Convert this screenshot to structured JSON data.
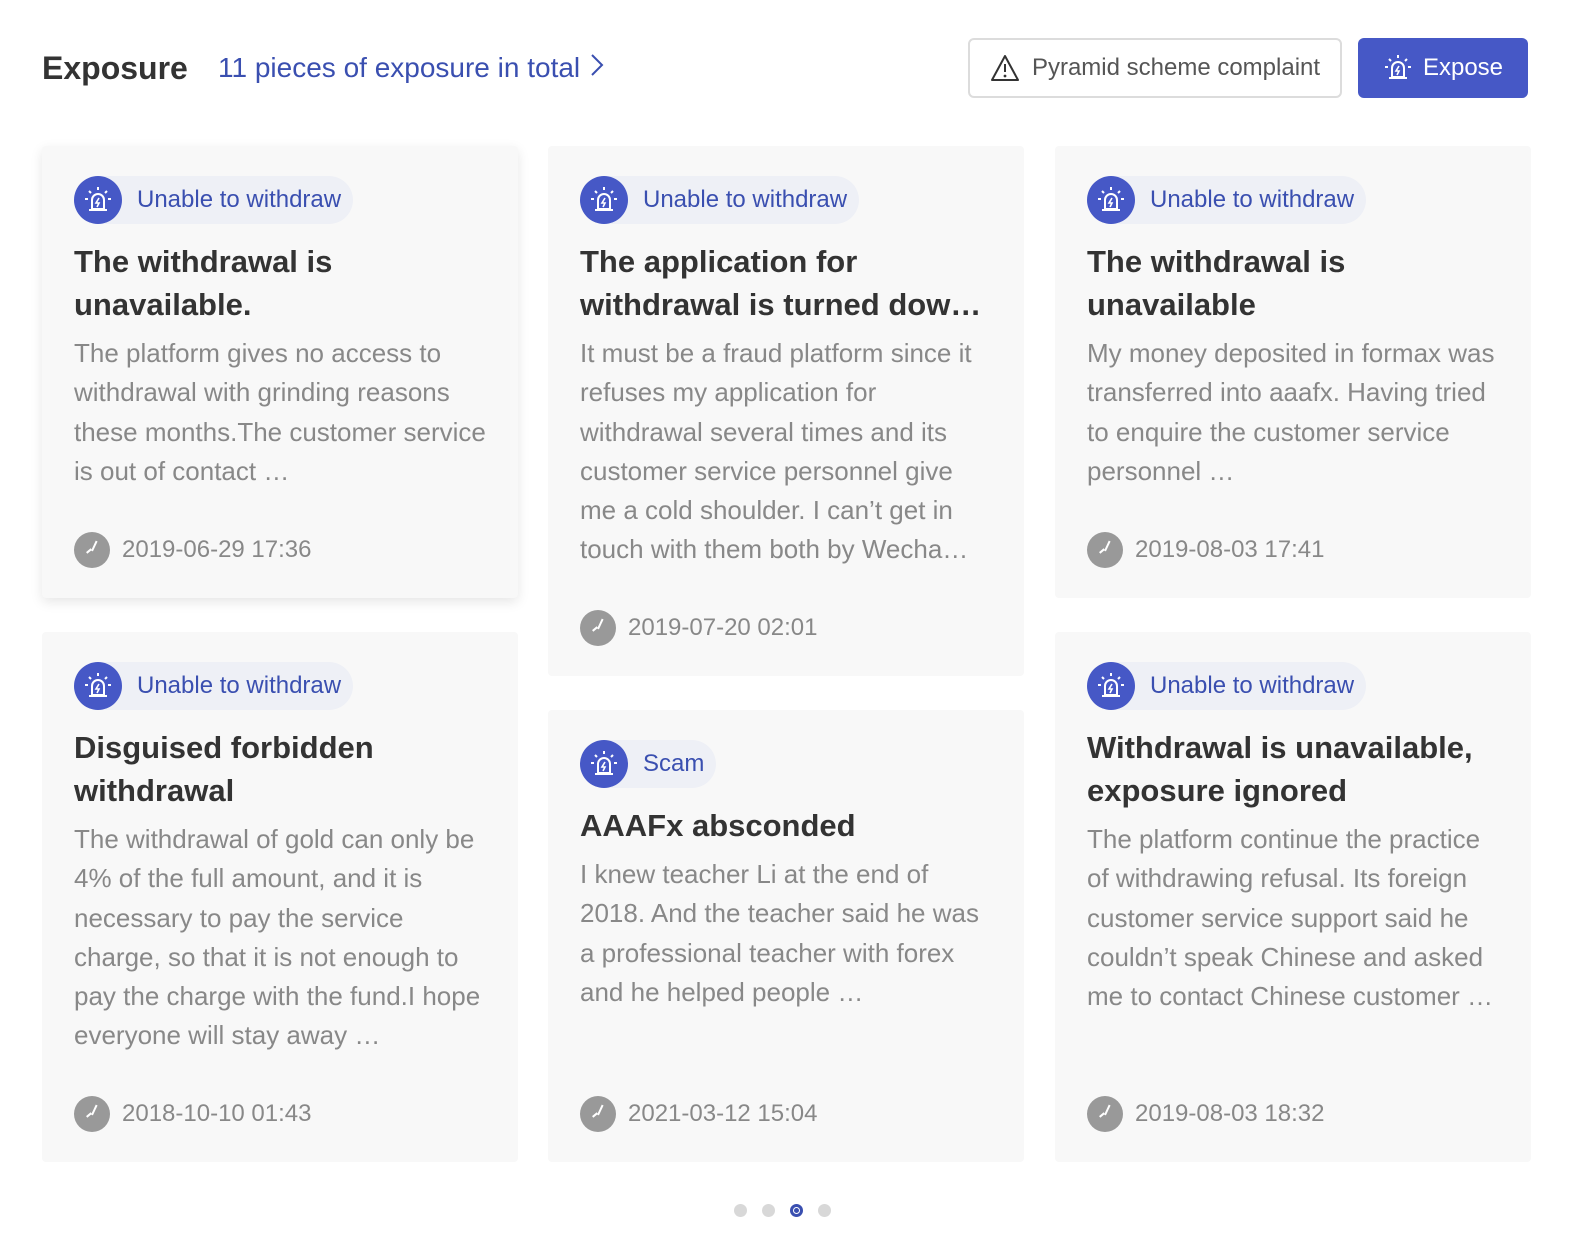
{
  "header": {
    "title": "Exposure",
    "total_link": "11 pieces of exposure in total",
    "complaint_button": "Pyramid scheme complaint",
    "expose_button": "Expose"
  },
  "colors": {
    "accent": "#4658c6",
    "link": "#3a4fb0",
    "card_bg": "#f8f8f8"
  },
  "cards": [
    {
      "tag": "Unable to withdraw",
      "title": "The withdrawal is unavailable.",
      "body": "The platform gives no access to withdrawal with grinding reasons these months.The customer service is out of contact …",
      "time": "2019-06-29 17:36"
    },
    {
      "tag": "Unable to withdraw",
      "title": "The application for withdrawal is turned dow…",
      "body": "It must be a fraud platform since it refuses my application for withdrawal several times and its customer service personnel give me a cold shoulder. I can’t get in touch with them both by Wecha…",
      "time": "2019-07-20 02:01"
    },
    {
      "tag": "Unable to withdraw",
      "title": "The withdrawal is unavailable",
      "body": "My money deposited in formax was transferred into aaafx. Having tried to enquire the customer service personnel …",
      "time": "2019-08-03 17:41"
    },
    {
      "tag": "Unable to withdraw",
      "title": "Disguised forbidden withdrawal",
      "body": "The withdrawal of gold can only be 4% of the full amount, and it is necessary to pay the service charge, so that it is not enough to pay the charge with the fund.I hope everyone will stay away …",
      "time": "2018-10-10 01:43"
    },
    {
      "tag": "Scam",
      "title": "AAAFx absconded",
      "body": "I knew teacher Li at the end of 2018. And the teacher said he was a professional teacher with forex and he helped people …",
      "time": "2021-03-12 15:04"
    },
    {
      "tag": "Unable to withdraw",
      "title": "Withdrawal is unavailable, exposure ignored",
      "body": "The platform continue the practice of withdrawing refusal. Its foreign customer service support said he couldn’t speak Chinese and asked me to contact Chinese customer …",
      "time": "2019-08-03 18:32"
    }
  ],
  "pagination": {
    "pages": 4,
    "active_page": 3
  }
}
